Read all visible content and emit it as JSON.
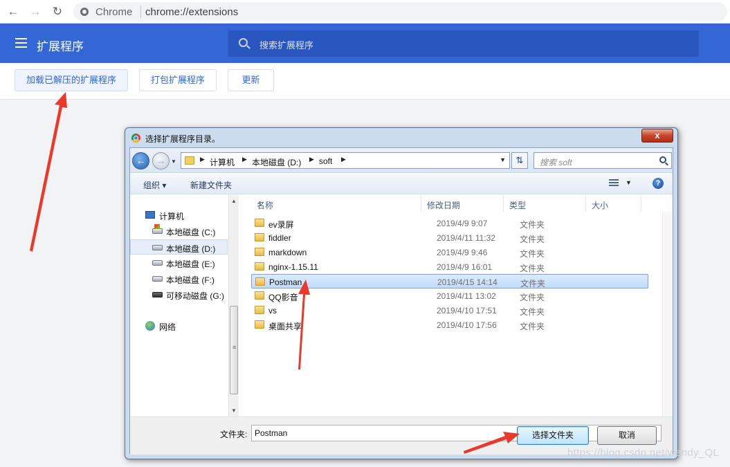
{
  "browser": {
    "site_label": "Chrome",
    "url": "chrome://extensions"
  },
  "extensions": {
    "title": "扩展程序",
    "search_placeholder": "搜索扩展程序",
    "buttons": {
      "load_unpacked": "加载已解压的扩展程序",
      "pack": "打包扩展程序",
      "update": "更新"
    }
  },
  "dialog": {
    "title": "选择扩展程序目录。",
    "close_glyph": "x",
    "path": [
      "计算机",
      "本地磁盘 (D:)",
      "soft"
    ],
    "search_placeholder": "搜索 soft",
    "commands": {
      "organize": "组织 ▾",
      "new_folder": "新建文件夹"
    },
    "tree": [
      {
        "label": "计算机",
        "icon": "computer-icon"
      },
      {
        "label": "本地磁盘 (C:)",
        "icon": "system-drive-icon"
      },
      {
        "label": "本地磁盘 (D:)",
        "icon": "drive-icon",
        "selected": true
      },
      {
        "label": "本地磁盘 (E:)",
        "icon": "drive-icon"
      },
      {
        "label": "本地磁盘 (F:)",
        "icon": "drive-icon"
      },
      {
        "label": "可移动磁盘 (G:)",
        "icon": "removable-drive-icon"
      },
      {
        "label": "网络",
        "icon": "network-icon"
      }
    ],
    "columns": {
      "name": "名称",
      "modified": "修改日期",
      "type": "类型",
      "size": "大小"
    },
    "files": [
      {
        "name": "ev录屏",
        "modified": "2019/4/9 9:07",
        "type": "文件夹"
      },
      {
        "name": "fiddler",
        "modified": "2019/4/11 11:32",
        "type": "文件夹"
      },
      {
        "name": "markdown",
        "modified": "2019/4/9 9:46",
        "type": "文件夹"
      },
      {
        "name": "nginx-1.15.11",
        "modified": "2019/4/9 16:01",
        "type": "文件夹"
      },
      {
        "name": "Postman",
        "modified": "2019/4/15 14:14",
        "type": "文件夹",
        "selected": true
      },
      {
        "name": "QQ影音",
        "modified": "2019/4/11 13:02",
        "type": "文件夹"
      },
      {
        "name": "vs",
        "modified": "2019/4/10 17:51",
        "type": "文件夹"
      },
      {
        "name": "桌面共享",
        "modified": "2019/4/10 17:56",
        "type": "文件夹"
      }
    ],
    "folder_label": "文件夹:",
    "folder_value": "Postman",
    "select_button": "选择文件夹",
    "cancel_button": "取消"
  },
  "watermark": "https://blog.csdn.net/wendy_QL",
  "colors": {
    "header_blue": "#3367d6",
    "annotation_arrow": "#e8392b"
  }
}
